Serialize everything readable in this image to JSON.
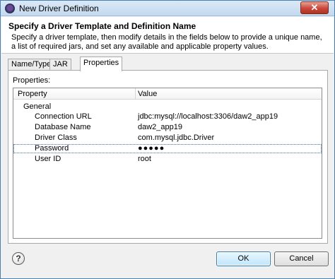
{
  "window": {
    "title": "New Driver Definition",
    "close_label": "✕"
  },
  "header": {
    "title": "Specify a Driver Template and Definition Name",
    "description": "Specify a driver template, then modify details in the fields below to provide a unique name, a list of required jars, and set any available and applicable property values."
  },
  "tabs": [
    {
      "label": "Name/Type"
    },
    {
      "label": "JAR List"
    },
    {
      "label": "Properties"
    }
  ],
  "properties": {
    "label": "Properties:",
    "columns": {
      "property": "Property",
      "value": "Value"
    },
    "group": "General",
    "rows": [
      {
        "name": "Connection URL",
        "value": "jdbc:mysql://localhost:3306/daw2_app19"
      },
      {
        "name": "Database Name",
        "value": "daw2_app19"
      },
      {
        "name": "Driver Class",
        "value": "com.mysql.jdbc.Driver"
      },
      {
        "name": "Password",
        "value": "●●●●●"
      },
      {
        "name": "User ID",
        "value": "root"
      }
    ]
  },
  "buttons": {
    "help": "?",
    "ok": "OK",
    "cancel": "Cancel"
  },
  "icons": {
    "window": "eclipse-icon",
    "help": "help-icon",
    "close": "close-icon"
  }
}
